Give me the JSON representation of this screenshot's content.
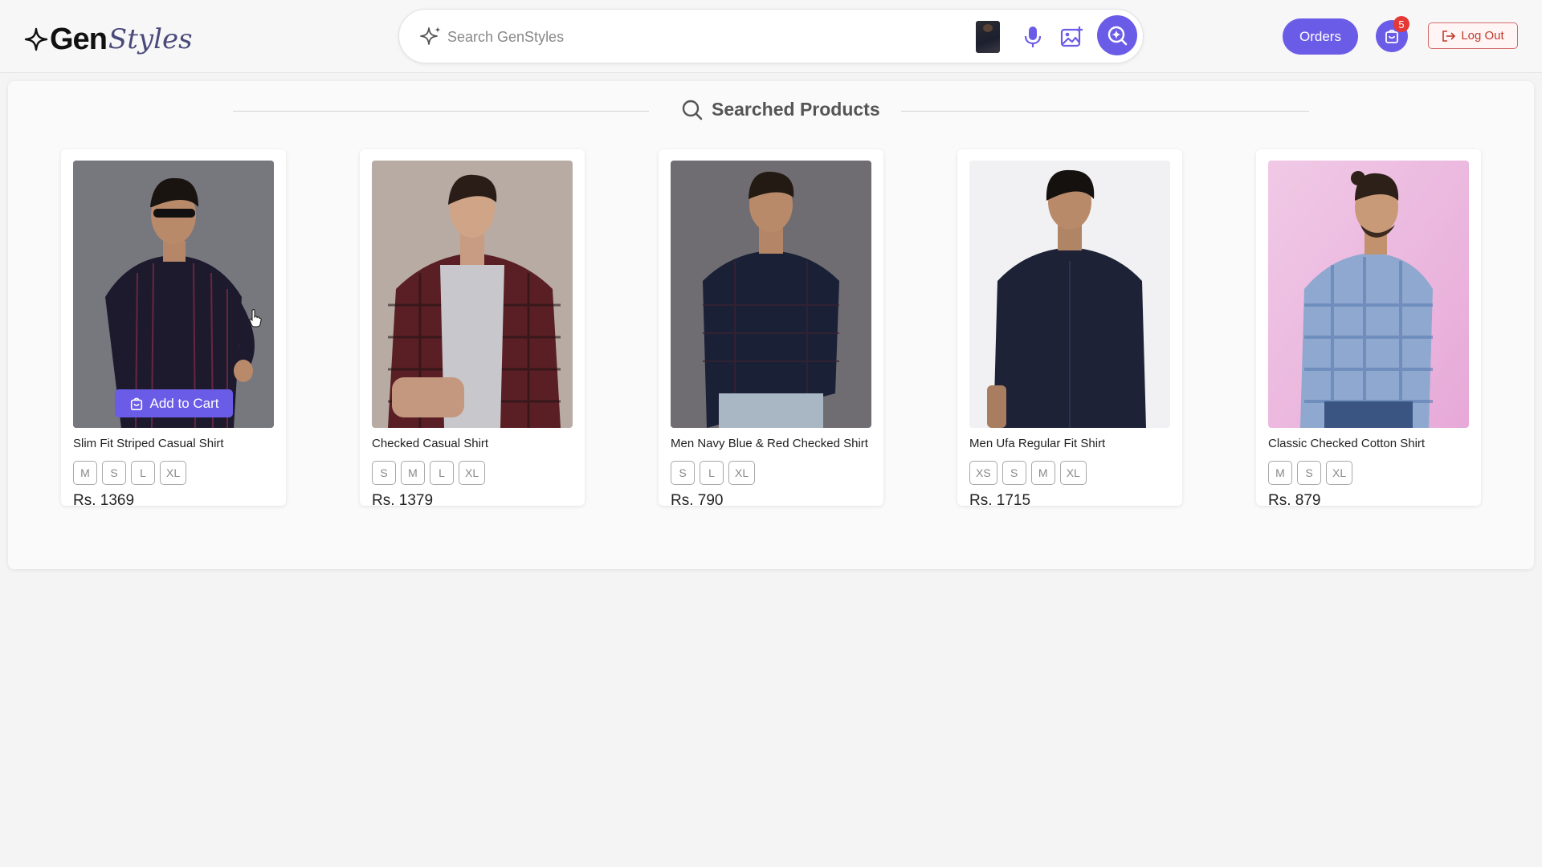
{
  "header": {
    "logo": {
      "part1": "Gen",
      "part2": "Styles"
    },
    "search": {
      "placeholder": "Search GenStyles",
      "value": ""
    },
    "orders_label": "Orders",
    "cart_count": "5",
    "logout_label": "Log Out"
  },
  "main": {
    "section_title": "Searched Products",
    "add_to_cart_label": "Add to Cart",
    "products": [
      {
        "name": "Slim Fit Striped Casual Shirt",
        "sizes": [
          "M",
          "S",
          "L",
          "XL"
        ],
        "price": "Rs. 1369"
      },
      {
        "name": "Checked Casual Shirt",
        "sizes": [
          "S",
          "M",
          "L",
          "XL"
        ],
        "price": "Rs. 1379"
      },
      {
        "name": "Men Navy Blue & Red Checked Shirt",
        "sizes": [
          "S",
          "L",
          "XL"
        ],
        "price": "Rs. 790"
      },
      {
        "name": "Men Ufa Regular Fit Shirt",
        "sizes": [
          "XS",
          "S",
          "M",
          "XL"
        ],
        "price": "Rs. 1715"
      },
      {
        "name": "Classic Checked Cotton Shirt",
        "sizes": [
          "M",
          "S",
          "XL"
        ],
        "price": "Rs. 879"
      }
    ]
  },
  "colors": {
    "accent": "#6b5ce7",
    "badge": "#e53935",
    "logout": "#c0392b"
  }
}
